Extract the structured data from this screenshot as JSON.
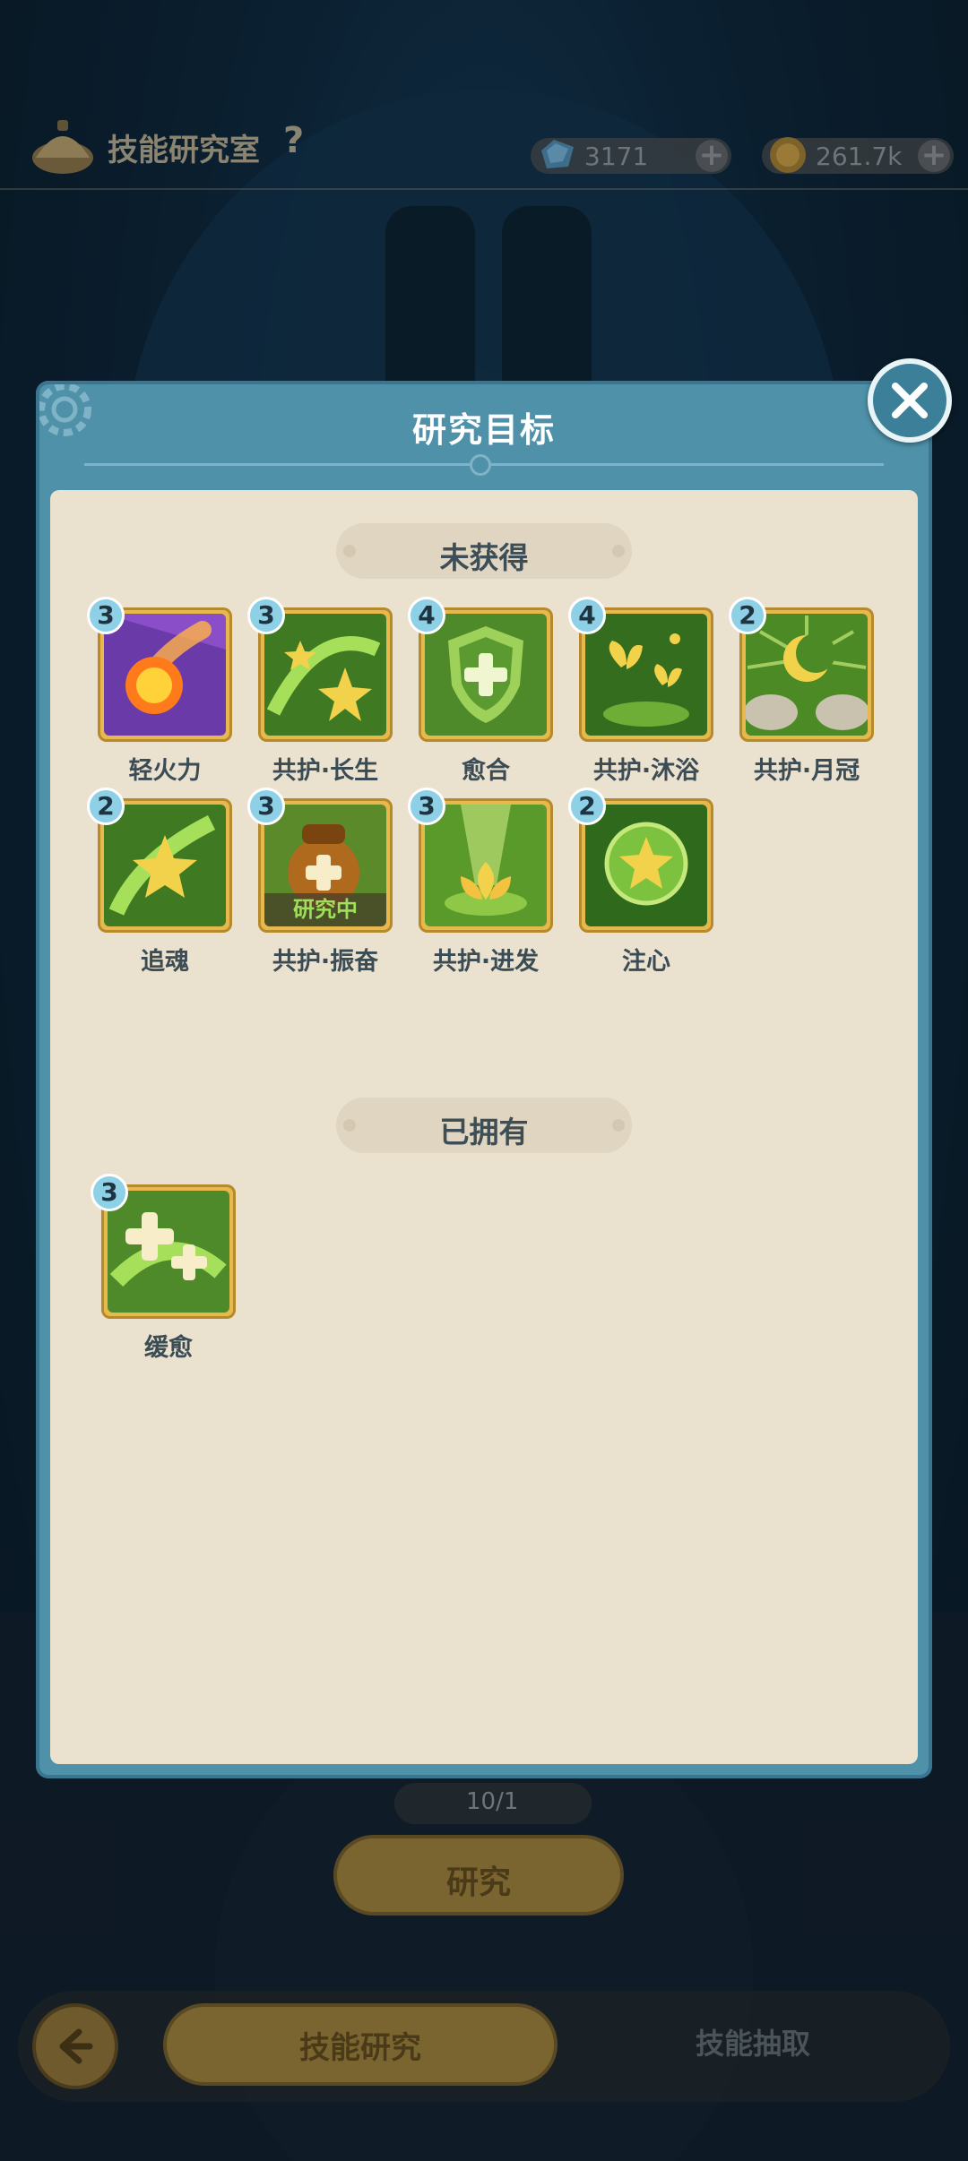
{
  "header": {
    "title": "技能研究室",
    "help_label": "?",
    "gems": "3171",
    "coins": "261.7k",
    "add_label": "+"
  },
  "dialog": {
    "title": "研究目标",
    "close_label": "close",
    "sections": {
      "unowned": {
        "label": "未获得",
        "skills": [
          {
            "name": "轻火力",
            "level": "3",
            "icon": "fireball-icon"
          },
          {
            "name": "共护·长生",
            "level": "3",
            "icon": "star-swirl-icon"
          },
          {
            "name": "愈合",
            "level": "4",
            "icon": "shield-cross-icon"
          },
          {
            "name": "共护·沐浴",
            "level": "4",
            "icon": "butterflies-icon"
          },
          {
            "name": "共护·月冠",
            "level": "2",
            "icon": "crescent-moon-icon"
          },
          {
            "name": "追魂",
            "level": "2",
            "icon": "star-slash-icon"
          },
          {
            "name": "共护·振奋",
            "level": "3",
            "icon": "potion-pouch-icon",
            "status": "研究中"
          },
          {
            "name": "共护·进发",
            "level": "3",
            "icon": "lotus-icon"
          },
          {
            "name": "注心",
            "level": "2",
            "icon": "star-orb-icon"
          }
        ]
      },
      "owned": {
        "label": "已拥有",
        "skills": [
          {
            "name": "缓愈",
            "level": "3",
            "icon": "double-cross-icon"
          }
        ]
      }
    }
  },
  "background": {
    "cost": "10/1",
    "research_button": "研究",
    "tab_skill_research": "技能研究",
    "tab_skill_draw": "技能抽取"
  },
  "colors": {
    "dialog_frame": "#4f91a9",
    "panel": "#ebe1cf",
    "icon_frame": "#e7b84c",
    "level_badge": "#8ed0e6",
    "status_text": "#9fe05a"
  }
}
